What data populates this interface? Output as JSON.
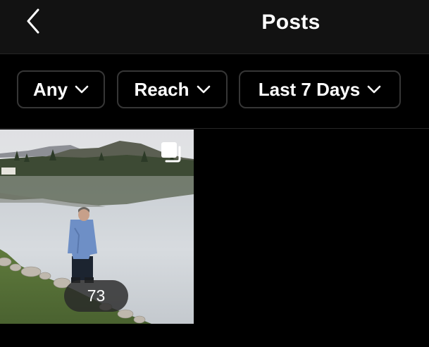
{
  "header": {
    "title": "Posts",
    "back_icon": "chevron-left-icon"
  },
  "filters": [
    {
      "label": "Any",
      "icon": "chevron-down-icon"
    },
    {
      "label": "Reach",
      "icon": "chevron-down-icon"
    },
    {
      "label": "Last 7 Days",
      "icon": "chevron-down-icon"
    }
  ],
  "posts": [
    {
      "type_icon": "carousel-icon",
      "metric_value": "73"
    }
  ],
  "colors": {
    "background": "#000000",
    "header_background": "#121212",
    "chip_border": "#363636",
    "text": "#ffffff"
  }
}
